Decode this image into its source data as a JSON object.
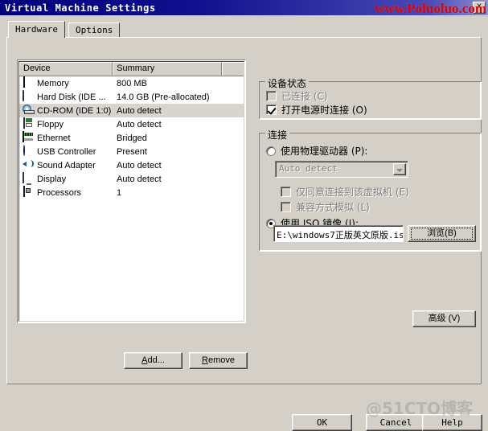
{
  "window": {
    "title": "Virtual Machine Settings",
    "close_label": "X"
  },
  "watermarks": {
    "top": "www.Poluoluo.com",
    "bottom": "@51CTO博客"
  },
  "tabs": [
    {
      "label": "Hardware",
      "active": true
    },
    {
      "label": "Options",
      "active": false
    }
  ],
  "device_list": {
    "columns": [
      "Device",
      "Summary",
      ""
    ],
    "rows": [
      {
        "icon": "memory-icon",
        "device": "Memory",
        "summary": "800 MB",
        "selected": false
      },
      {
        "icon": "hard-disk-icon",
        "device": "Hard Disk (IDE ...",
        "summary": "14.0 GB (Pre-allocated)",
        "selected": false
      },
      {
        "icon": "cd-rom-icon",
        "device": "CD-ROM (IDE 1:0)",
        "summary": "Auto detect",
        "selected": true
      },
      {
        "icon": "floppy-icon",
        "device": "Floppy",
        "summary": "Auto detect",
        "selected": false
      },
      {
        "icon": "ethernet-icon",
        "device": "Ethernet",
        "summary": "Bridged",
        "selected": false
      },
      {
        "icon": "usb-controller-icon",
        "device": "USB Controller",
        "summary": "Present",
        "selected": false
      },
      {
        "icon": "sound-adapter-icon",
        "device": "Sound Adapter",
        "summary": "Auto detect",
        "selected": false
      },
      {
        "icon": "display-icon",
        "device": "Display",
        "summary": "Auto detect",
        "selected": false
      },
      {
        "icon": "processors-icon",
        "device": "Processors",
        "summary": "1",
        "selected": false
      }
    ]
  },
  "list_buttons": {
    "add": "Add...",
    "add_accel": "A",
    "remove": "Remove",
    "remove_accel": "R"
  },
  "device_status": {
    "title": "设备状态",
    "connected": {
      "label": "已连接 (C)",
      "checked": false,
      "disabled": true
    },
    "connect_at_power_on": {
      "label": "打开电源时连接 (O)",
      "checked": true,
      "disabled": false
    }
  },
  "connection": {
    "title": "连接",
    "use_physical_drive": {
      "label": "使用物理驱动器 (P):",
      "selected": false
    },
    "physical_drive_value": "Auto detect",
    "exclusive_access": {
      "label": "仅同意连接到该虚拟机 (E)",
      "checked": false,
      "disabled": true
    },
    "legacy_emulation": {
      "label": "兼容方式模拟 (L)",
      "checked": false,
      "disabled": true
    },
    "use_iso_image": {
      "label": "使用 ISO 镜像 (I):",
      "selected": true
    },
    "iso_path": "E:\\windows7正版英文原版.is",
    "browse_button": "浏览(B)"
  },
  "advanced_button": "高级 (V)",
  "dialog_buttons": {
    "ok": "OK",
    "cancel": "Cancel",
    "help": "Help"
  }
}
